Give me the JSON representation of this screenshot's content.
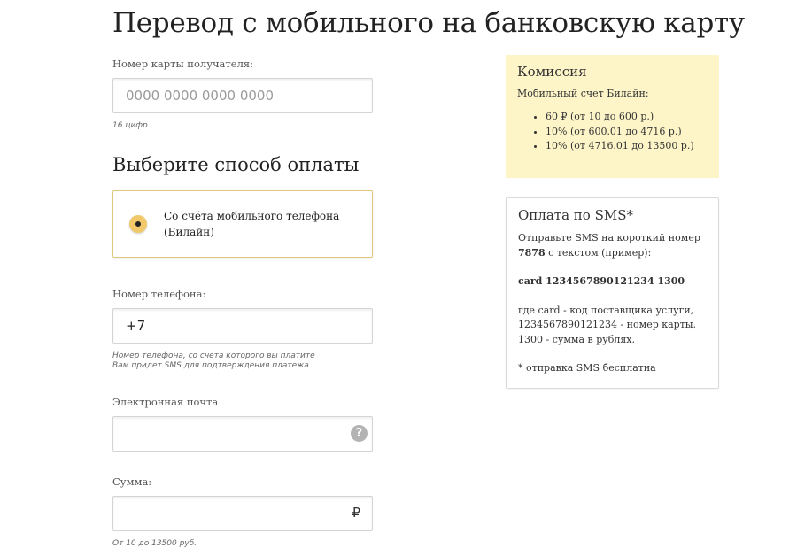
{
  "page": {
    "title": "Перевод с мобильного на банковскую карту"
  },
  "card_number": {
    "label": "Номер карты получателя:",
    "placeholder": "0000 0000 0000 0000",
    "hint": "16 цифр"
  },
  "payment_method": {
    "title": "Выберите способ оплаты",
    "option_label": "Со счёта мобильного телефона (Билайн)",
    "selected": true
  },
  "phone": {
    "label": "Номер телефона:",
    "value": "+7",
    "hint_line1": "Номер телефона, со счета которого вы платите",
    "hint_line2": "Вам придет SMS для подтверждения платежа"
  },
  "email": {
    "label": "Электронная почта",
    "help_icon": "?"
  },
  "amount": {
    "label": "Сумма:",
    "currency_symbol": "₽",
    "hint": "От 10 до 13500 руб."
  },
  "commission": {
    "title": "Комиссия",
    "subtitle": "Мобильный счет Билайн:",
    "items": [
      "60 ₽ (от 10 до 600 р.)",
      "10% (от 600.01 до 4716 р.)",
      "10% (от 4716.01 до 13500 р.)"
    ]
  },
  "sms": {
    "title": "Оплата по SMS*",
    "intro_prefix": "Отправьте SMS на короткий номер ",
    "short_number": "7878",
    "intro_suffix": " с текстом (пример):",
    "example": "card 1234567890121234 1300",
    "explain_line1": "где card - код поставщика услуги,",
    "explain_line2": "1234567890121234 - номер карты,",
    "explain_line3": "1300 - сумма в рублях.",
    "footnote": "* отправка SMS бесплатна"
  },
  "colors": {
    "radio_accent": "#f1c96a",
    "option_border": "#e0c87a",
    "commission_bg": "#fdf5c8"
  }
}
